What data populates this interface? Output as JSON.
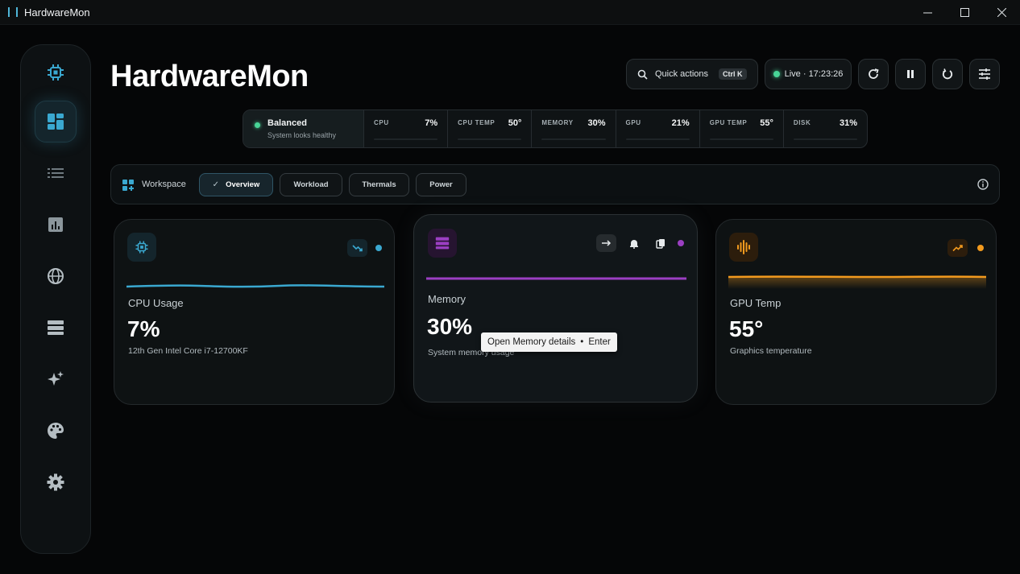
{
  "window": {
    "title": "HardwareMon"
  },
  "header": {
    "title": "HardwareMon",
    "quick_actions_label": "Quick actions",
    "quick_actions_shortcut": "Ctrl K",
    "live_label": "Live · 17:23:26"
  },
  "status_strip": {
    "mode": "Balanced",
    "mode_detail": "System looks healthy",
    "metrics": [
      {
        "label": "CPU",
        "value": "7%",
        "fraction": 0.07
      },
      {
        "label": "CPU TEMP",
        "value": "50°",
        "fraction": 0.5
      },
      {
        "label": "MEMORY",
        "value": "30%",
        "fraction": 0.3
      },
      {
        "label": "GPU",
        "value": "21%",
        "fraction": 0.21
      },
      {
        "label": "GPU TEMP",
        "value": "55°",
        "fraction": 0.55
      },
      {
        "label": "DISK",
        "value": "31%",
        "fraction": 0.31
      }
    ]
  },
  "workspace": {
    "label": "Workspace",
    "tabs": [
      {
        "label": "Overview",
        "active": true
      },
      {
        "label": "Workload"
      },
      {
        "label": "Thermals"
      },
      {
        "label": "Power"
      }
    ]
  },
  "cards": {
    "cpu": {
      "title": "CPU Usage",
      "value": "7%",
      "subtitle": "12th Gen Intel Core i7-12700KF",
      "accent": "#3aa8d0"
    },
    "memory": {
      "title": "Memory",
      "value": "30%",
      "subtitle": "System memory usage",
      "accent": "#9b3fc2"
    },
    "gpu": {
      "title": "GPU Temp",
      "value": "55°",
      "subtitle": "Graphics temperature",
      "accent": "#f29a1e"
    }
  },
  "tooltip": {
    "text": "Open Memory details",
    "separator": "•",
    "shortcut": "Enter"
  }
}
